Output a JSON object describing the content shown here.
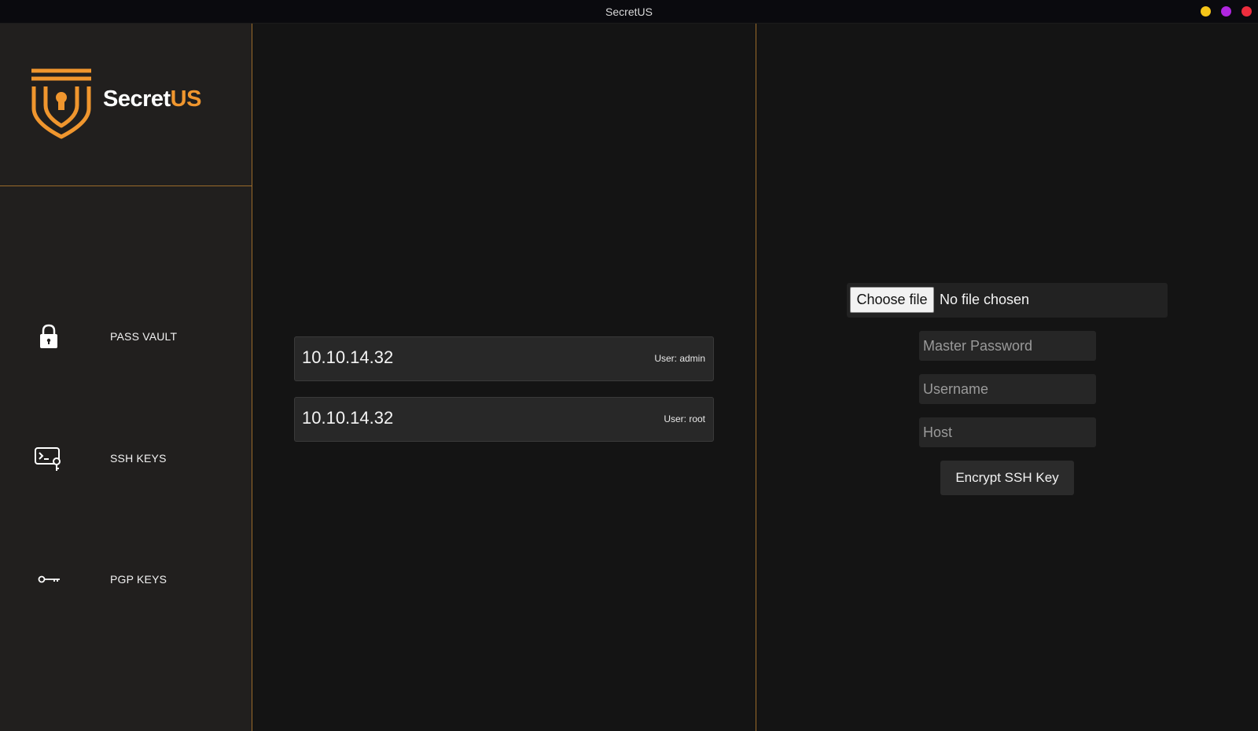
{
  "window": {
    "title": "SecretUS",
    "controls": [
      {
        "name": "minimize",
        "color": "#f5c518"
      },
      {
        "name": "maximize",
        "color": "#b026e0"
      },
      {
        "name": "close",
        "color": "#ee2d3d"
      }
    ]
  },
  "brand": {
    "logo_text_part1": "Secret",
    "logo_text_part2": "US",
    "accent_color": "#f0962e",
    "icon": "shield-keyhole-icon"
  },
  "sidebar": {
    "items": [
      {
        "label": "PASS VAULT",
        "icon": "lock-icon"
      },
      {
        "label": "SSH KEYS",
        "icon": "terminal-key-icon"
      },
      {
        "label": "PGP KEYS",
        "icon": "key-icon"
      }
    ]
  },
  "entries": [
    {
      "host": "10.10.14.32",
      "user": "User: admin"
    },
    {
      "host": "10.10.14.32",
      "user": "User: root"
    }
  ],
  "form": {
    "file_button": "Choose file",
    "file_status": "No file chosen",
    "master_password_placeholder": "Master Password",
    "username_placeholder": "Username",
    "host_placeholder": "Host",
    "submit_label": "Encrypt SSH Key"
  }
}
